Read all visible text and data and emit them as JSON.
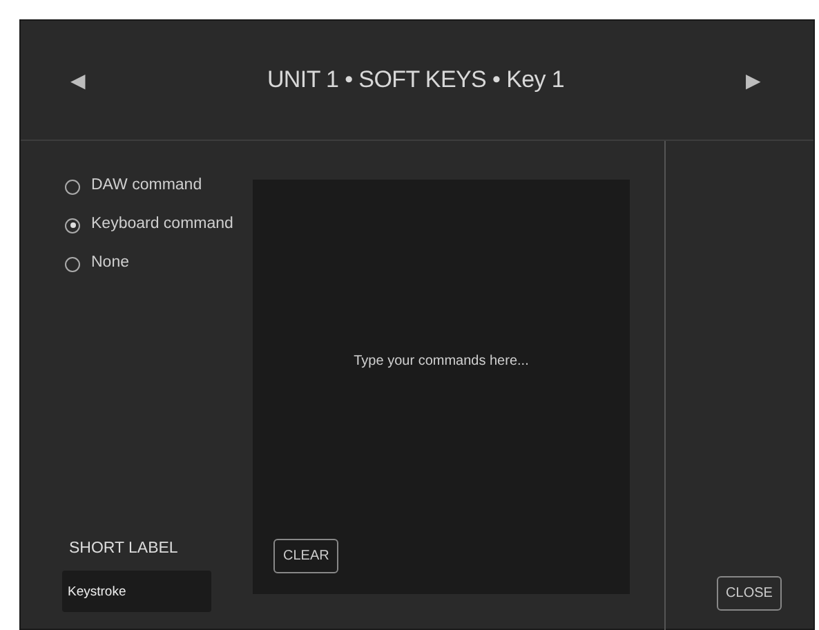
{
  "header": {
    "title": "UNIT 1 • SOFT KEYS • Key 1",
    "prev": "◀",
    "next": "▶"
  },
  "command_types": [
    {
      "label": "DAW command",
      "selected": false
    },
    {
      "label": "Keyboard command",
      "selected": true
    },
    {
      "label": "None",
      "selected": false
    }
  ],
  "commands": {
    "placeholder": "Type your commands here..."
  },
  "clear_button": "CLEAR",
  "short_label": {
    "label": "SHORT LABEL",
    "value": "Keystroke"
  },
  "close_button": "CLOSE"
}
